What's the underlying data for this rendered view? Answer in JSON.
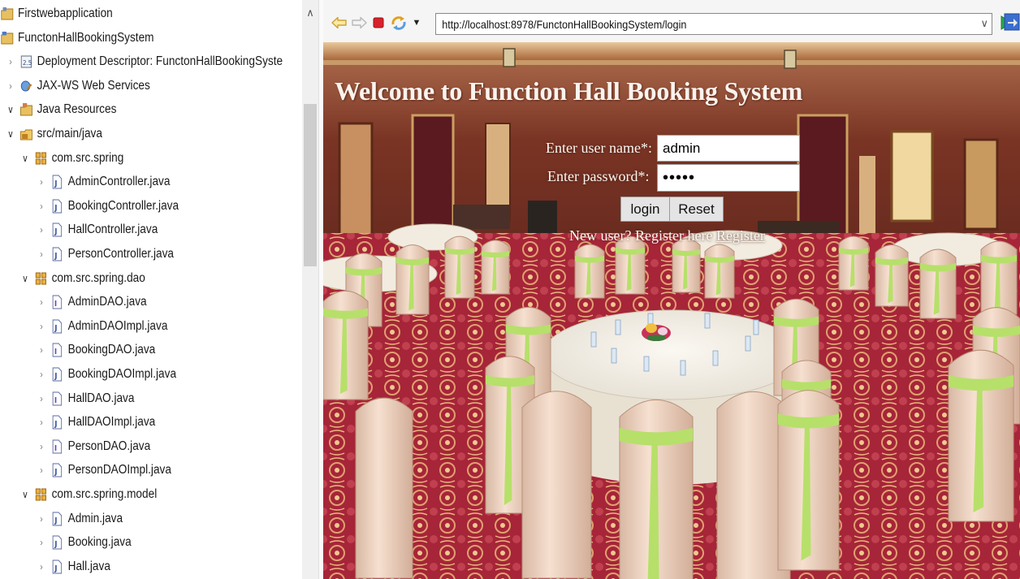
{
  "explorer": {
    "items": [
      {
        "label": "Firstwebapplication",
        "depth": 0,
        "twisty": "",
        "icon": "project-icon"
      },
      {
        "label": "FunctonHallBookingSystem",
        "depth": 0,
        "twisty": "",
        "icon": "web-project-icon"
      },
      {
        "label": "Deployment Descriptor: FunctonHallBookingSyste",
        "depth": 1,
        "twisty": "collapsed",
        "icon": "deployment-descriptor-icon"
      },
      {
        "label": "JAX-WS Web Services",
        "depth": 1,
        "twisty": "collapsed",
        "icon": "web-services-icon"
      },
      {
        "label": "Java Resources",
        "depth": 1,
        "twisty": "expanded",
        "icon": "java-resources-icon"
      },
      {
        "label": "src/main/java",
        "depth": 2,
        "twisty": "expanded",
        "icon": "source-folder-icon"
      },
      {
        "label": "com.src.spring",
        "depth": 3,
        "twisty": "expanded",
        "icon": "package-icon"
      },
      {
        "label": "AdminController.java",
        "depth": 4,
        "twisty": "collapsed",
        "icon": "java-file-icon"
      },
      {
        "label": "BookingController.java",
        "depth": 4,
        "twisty": "collapsed",
        "icon": "java-file-icon"
      },
      {
        "label": "HallController.java",
        "depth": 4,
        "twisty": "collapsed",
        "icon": "java-file-icon"
      },
      {
        "label": "PersonController.java",
        "depth": 4,
        "twisty": "collapsed",
        "icon": "java-file-icon"
      },
      {
        "label": "com.src.spring.dao",
        "depth": 3,
        "twisty": "expanded",
        "icon": "package-icon"
      },
      {
        "label": "AdminDAO.java",
        "depth": 4,
        "twisty": "collapsed",
        "icon": "java-interface-icon"
      },
      {
        "label": "AdminDAOImpl.java",
        "depth": 4,
        "twisty": "collapsed",
        "icon": "java-file-icon"
      },
      {
        "label": "BookingDAO.java",
        "depth": 4,
        "twisty": "collapsed",
        "icon": "java-interface-icon"
      },
      {
        "label": "BookingDAOImpl.java",
        "depth": 4,
        "twisty": "collapsed",
        "icon": "java-file-icon"
      },
      {
        "label": "HallDAO.java",
        "depth": 4,
        "twisty": "collapsed",
        "icon": "java-interface-icon"
      },
      {
        "label": "HallDAOImpl.java",
        "depth": 4,
        "twisty": "collapsed",
        "icon": "java-file-icon"
      },
      {
        "label": "PersonDAO.java",
        "depth": 4,
        "twisty": "collapsed",
        "icon": "java-interface-icon"
      },
      {
        "label": "PersonDAOImpl.java",
        "depth": 4,
        "twisty": "collapsed",
        "icon": "java-file-icon"
      },
      {
        "label": "com.src.spring.model",
        "depth": 3,
        "twisty": "expanded",
        "icon": "package-icon"
      },
      {
        "label": "Admin.java",
        "depth": 4,
        "twisty": "collapsed",
        "icon": "java-file-icon"
      },
      {
        "label": "Booking.java",
        "depth": 4,
        "twisty": "collapsed",
        "icon": "java-file-icon"
      },
      {
        "label": "Hall.java",
        "depth": 4,
        "twisty": "collapsed",
        "icon": "java-file-icon"
      }
    ]
  },
  "browser": {
    "url": "http://localhost:8978/FunctonHallBookingSystem/login",
    "toolbar_icons": [
      "back-arrow-icon",
      "forward-arrow-icon",
      "stop-icon",
      "refresh-icon",
      "dropdown-arrow-icon",
      "go-play-icon",
      "open-browser-icon"
    ]
  },
  "page": {
    "heading": "Welcome to Function Hall Booking System",
    "username_label": "Enter user name*:",
    "username_value": "admin",
    "password_label": "Enter password*:",
    "password_mask": "•••••",
    "login_button": "login",
    "reset_button": "Reset",
    "new_user_text": "New user? Register here",
    "register_link": "Register"
  },
  "colors": {
    "sash": "#b6e06a",
    "chair_cover": "#f3d9c6",
    "carpet": "#a82838",
    "wall": "#8a3c2a",
    "stop": "#d8222a",
    "go": "#2aa84a"
  }
}
